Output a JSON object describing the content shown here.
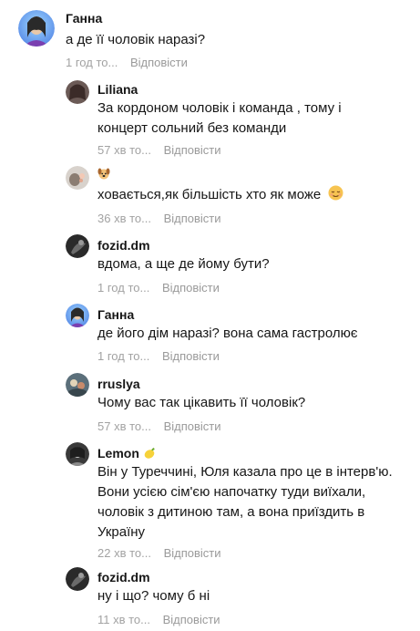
{
  "comments": [
    {
      "author": "Ганна",
      "text": "а де її чоловік наразі?",
      "time": "1 год то...",
      "reply": "Відповісти",
      "avatar": "avatar-ganna"
    },
    {
      "author": "Liliana",
      "text": "За кордоном чоловік і команда , тому і концерт сольний без команди",
      "time": "57 хв то...",
      "reply": "Відповісти",
      "avatar": "avatar-liliana"
    },
    {
      "author": "",
      "author_emoji": "dog-emoji",
      "text": "ховається,як більшість хто як може",
      "text_emoji": "relieved-face-emoji",
      "time": "36 хв то...",
      "reply": "Відповісти",
      "avatar": "avatar-dog"
    },
    {
      "author": "fozid.dm",
      "text": "вдома, а ще де йому бути?",
      "time": "1 год то...",
      "reply": "Відповісти",
      "avatar": "avatar-fozid"
    },
    {
      "author": "Ганна",
      "text": "де його дім наразі? вона сама гастролює",
      "time": "1 год то...",
      "reply": "Відповісти",
      "avatar": "avatar-ganna"
    },
    {
      "author": "rruslya",
      "text": "Чому вас так цікавить її чоловік?",
      "time": "57 хв то...",
      "reply": "Відповісти",
      "avatar": "avatar-rruslya"
    },
    {
      "author": "Lemon",
      "author_emoji": "lemon-emoji",
      "text": "Він у Туреччині, Юля казала про це в інтерв'ю. Вони усією сім'єю напочатку туди виїхали, чоловік з дитиною там, а вона приїздить в Україну",
      "time": "22 хв то...",
      "reply": "Відповісти",
      "avatar": "avatar-lemon"
    },
    {
      "author": "fozid.dm",
      "text": "ну і що? чому б ні",
      "time": "11 хв то...",
      "reply": "Відповісти",
      "avatar": "avatar-fozid"
    }
  ]
}
